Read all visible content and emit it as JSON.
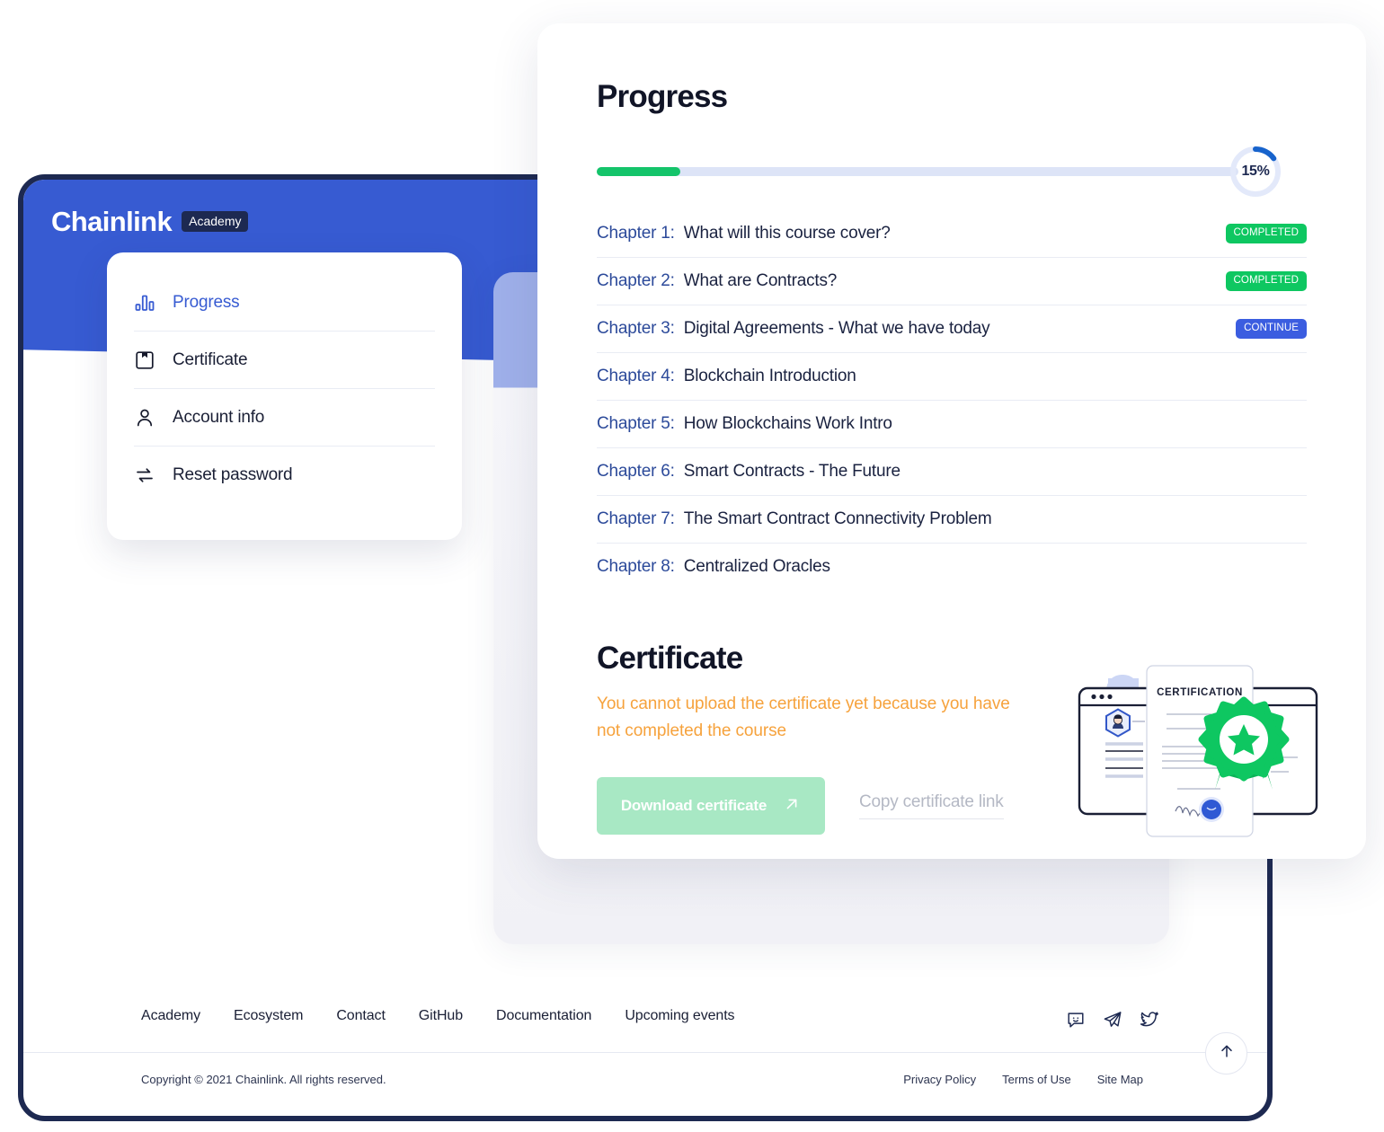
{
  "brand": {
    "name": "Chainlink",
    "badge": "Academy"
  },
  "sidebar": {
    "items": [
      {
        "label": "Progress",
        "icon": "bar-chart-icon",
        "active": true
      },
      {
        "label": "Certificate",
        "icon": "save-icon",
        "active": false
      },
      {
        "label": "Account info",
        "icon": "user-icon",
        "active": false
      },
      {
        "label": "Reset password",
        "icon": "refresh-icon",
        "active": false
      }
    ]
  },
  "progress": {
    "title": "Progress",
    "percent_label": "15%",
    "percent_value": 15,
    "bar_fill_percent": 13,
    "chapters": [
      {
        "num": "Chapter 1:",
        "title": "What will this course cover?",
        "badge": "COMPLETED",
        "badge_type": "completed"
      },
      {
        "num": "Chapter 2:",
        "title": "What are Contracts?",
        "badge": "COMPLETED",
        "badge_type": "completed"
      },
      {
        "num": "Chapter 3:",
        "title": "Digital Agreements - What we have today",
        "badge": "CONTINUE",
        "badge_type": "continue"
      },
      {
        "num": "Chapter 4:",
        "title": "Blockchain Introduction",
        "badge": "",
        "badge_type": "none"
      },
      {
        "num": "Chapter 5:",
        "title": "How Blockchains Work Intro",
        "badge": "",
        "badge_type": "none"
      },
      {
        "num": "Chapter 6:",
        "title": "Smart Contracts - The Future",
        "badge": "",
        "badge_type": "none"
      },
      {
        "num": "Chapter 7:",
        "title": "The Smart Contract Connectivity Problem",
        "badge": "",
        "badge_type": "none"
      },
      {
        "num": "Chapter 8:",
        "title": "Centralized Oracles",
        "badge": "",
        "badge_type": "none"
      }
    ]
  },
  "certificate": {
    "title": "Certificate",
    "warning": "You cannot upload the certificate yet because you have not completed the course",
    "download_label": "Download certificate",
    "copy_link_label": "Copy certificate link",
    "illustration_heading": "CERTIFICATION"
  },
  "footer": {
    "links": [
      "Academy",
      "Ecosystem",
      "Contact",
      "GitHub",
      "Documentation",
      "Upcoming events"
    ],
    "social": [
      "chat-icon",
      "telegram-icon",
      "twitter-icon"
    ],
    "copyright": "Copyright © 2021 Chainlink. All rights reserved.",
    "legal": [
      "Privacy Policy",
      "Terms of Use",
      "Site Map"
    ],
    "scroll_top": "scroll-to-top"
  },
  "colors": {
    "brand_blue": "#375bd2",
    "dark_navy": "#1d2951",
    "green": "#0ec761",
    "progress_green": "#14c46a",
    "orange": "#f6a23c",
    "track_blue": "#dde4f7",
    "disabled_green": "#a8e8c4"
  }
}
